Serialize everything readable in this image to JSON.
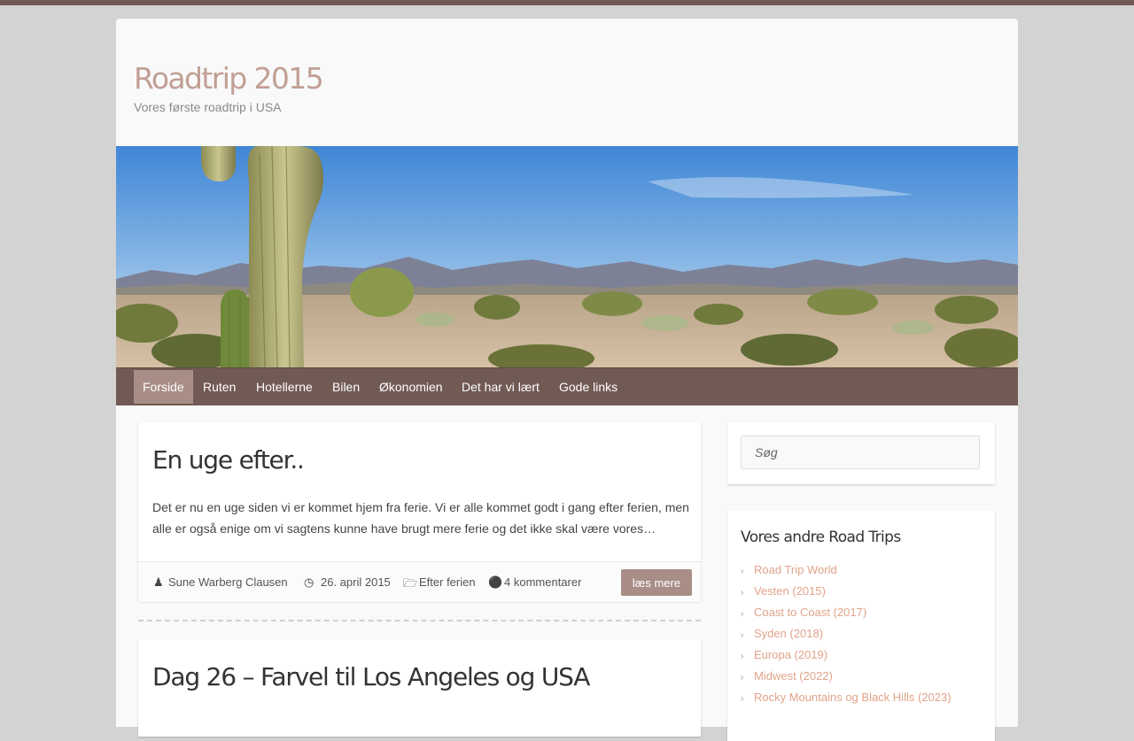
{
  "site": {
    "title": "Roadtrip 2015",
    "description": "Vores første roadtrip i USA"
  },
  "nav": {
    "items": [
      {
        "label": "Forside",
        "active": true
      },
      {
        "label": "Ruten"
      },
      {
        "label": "Hotellerne"
      },
      {
        "label": "Bilen"
      },
      {
        "label": "Økonomien"
      },
      {
        "label": "Det har vi lært"
      },
      {
        "label": "Gode links"
      }
    ]
  },
  "posts": [
    {
      "title": "En uge efter..",
      "excerpt": "Det er nu en uge siden vi er kommet hjem fra ferie. Vi er alle kommet godt i gang efter ferien, men alle er også enige om vi sagtens kunne have brugt mere ferie og det ikke skal være vores…",
      "author": "Sune Warberg Clausen",
      "date": "26. april 2015",
      "category": "Efter ferien",
      "comments": "4 kommentarer",
      "read_more": "læs mere"
    },
    {
      "title": "Dag 26 – Farvel til Los Angeles og USA"
    }
  ],
  "sidebar": {
    "search_placeholder": "Søg",
    "trips_title": "Vores andre Road Trips",
    "trips": [
      "Road Trip World",
      "Vesten (2015)",
      "Coast to Coast (2017)",
      "Syden (2018)",
      "Europa (2019)",
      "Midwest (2022)",
      "Rocky Mountains og Black Hills (2023)"
    ]
  },
  "colors": {
    "accent": "#715a54",
    "nav_active": "#a88e87",
    "title": "#c19f94",
    "link": "#e1a389"
  },
  "icons": {
    "author": "user-icon",
    "date": "clock-icon",
    "category": "folder-icon",
    "comments": "comment-icon"
  }
}
